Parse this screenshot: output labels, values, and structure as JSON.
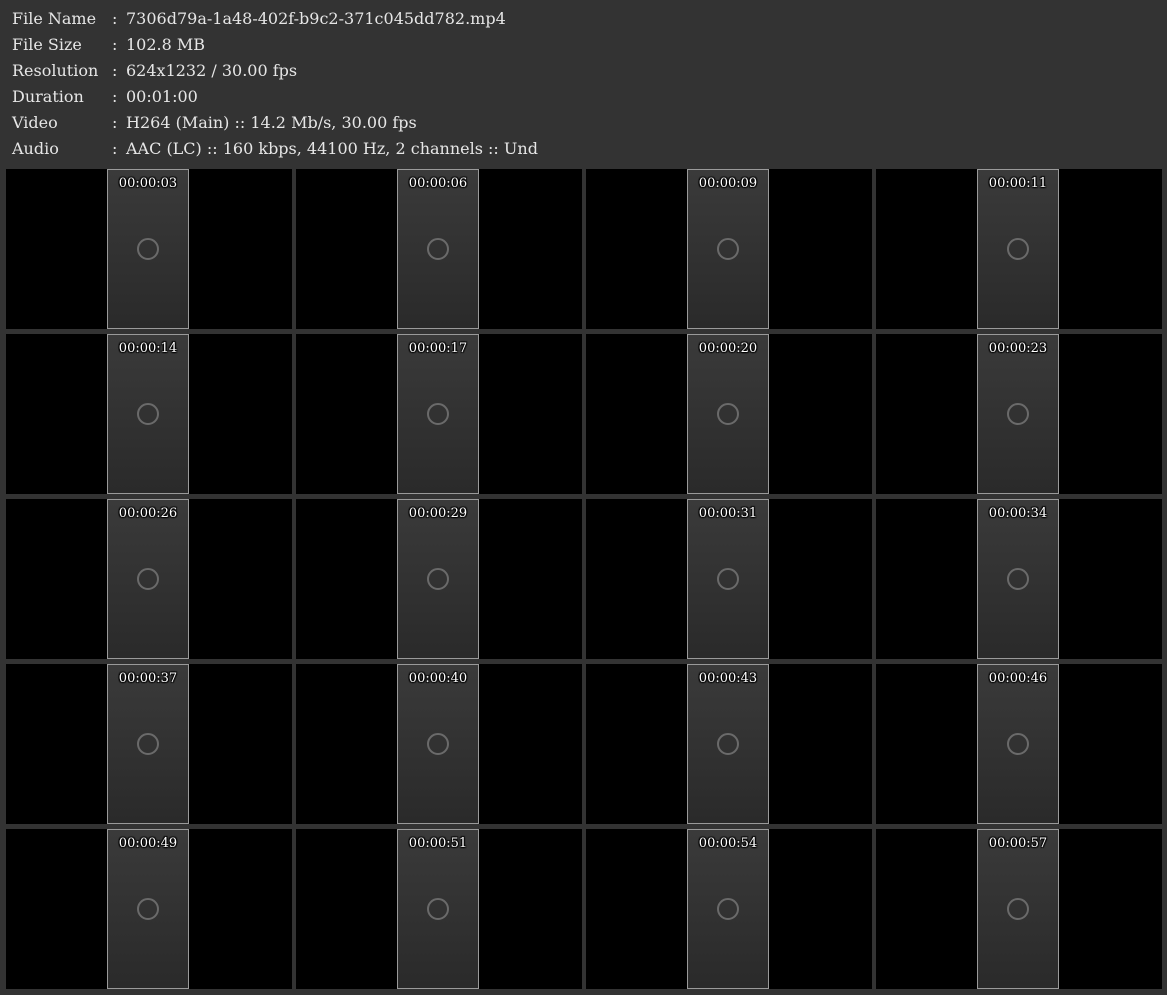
{
  "meta": {
    "separator": ":",
    "rows": [
      {
        "label": "File Name",
        "value": "7306d79a-1a48-402f-b9c2-371c045dd782.mp4"
      },
      {
        "label": "File Size",
        "value": "102.8 MB"
      },
      {
        "label": "Resolution",
        "value": "624x1232 / 30.00 fps"
      },
      {
        "label": "Duration",
        "value": "00:01:00"
      },
      {
        "label": "Video",
        "value": "H264 (Main) :: 14.2 Mb/s, 30.00 fps"
      },
      {
        "label": "Audio",
        "value": "AAC (LC) :: 160 kbps, 44100 Hz, 2 channels :: Und"
      }
    ]
  },
  "thumbnails": [
    "00:00:03",
    "00:00:06",
    "00:00:09",
    "00:00:11",
    "00:00:14",
    "00:00:17",
    "00:00:20",
    "00:00:23",
    "00:00:26",
    "00:00:29",
    "00:00:31",
    "00:00:34",
    "00:00:37",
    "00:00:40",
    "00:00:43",
    "00:00:46",
    "00:00:49",
    "00:00:51",
    "00:00:54",
    "00:00:57"
  ]
}
